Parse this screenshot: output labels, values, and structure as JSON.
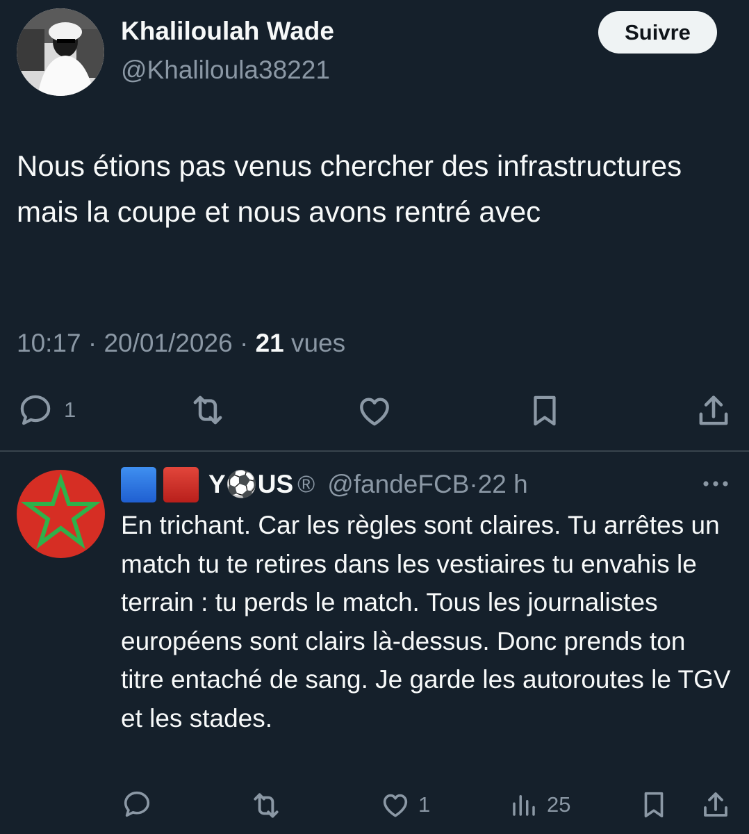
{
  "post": {
    "author_name": "Khaliloulah Wade",
    "author_handle": "@Khaliloula38221",
    "follow_label": "Suivre",
    "text": "Nous étions pas venus chercher des infrastructures mais la coupe et nous avons rentré avec",
    "time": "10:17",
    "sep1": " · ",
    "date": "20/01/2026",
    "sep2": " · ",
    "views_count": "21",
    "views_label": " vues",
    "actions": {
      "reply_count": "1"
    },
    "icons": [
      "reply-icon",
      "repost-icon",
      "like-icon",
      "bookmark-icon",
      "share-icon"
    ]
  },
  "reply": {
    "name": "Y⚽US",
    "registered_mark": "®",
    "handle": "@fandeFCB",
    "sep": " · ",
    "time": "22 h",
    "text": "En trichant. Car les règles sont claires. Tu arrêtes un match tu te retires dans les vestiaires tu envahis le terrain : tu perds le match. Tous les journalistes européens sont clairs là-dessus. Donc prends ton titre entaché de sang. Je garde les autoroutes le TGV et les stades.",
    "actions": {
      "like_count": "1",
      "views_count": "25"
    },
    "icons": [
      "reply-icon",
      "repost-icon",
      "like-icon",
      "views-icon",
      "bookmark-icon",
      "share-icon",
      "more-icon"
    ]
  },
  "colors": {
    "background": "#15202b",
    "text_primary": "#f7f9f9",
    "text_secondary": "#8b98a5",
    "divider": "#38444d",
    "follow_bg": "#eff3f4",
    "flag_red": "#d62e24",
    "star_green": "#2fb14a"
  }
}
